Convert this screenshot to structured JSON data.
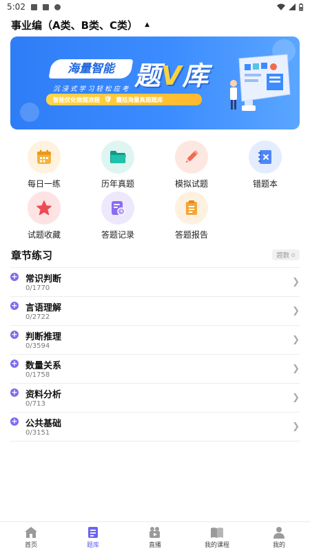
{
  "status": {
    "time": "5:02"
  },
  "header": {
    "exam_type": "事业编（A类、B类、C类）"
  },
  "banner": {
    "brand": "海量智能",
    "big_title_1": "题",
    "big_title_v": "V",
    "big_title_2": "库",
    "tagline": "沉浸式学习轻松应考",
    "badge_left": "智能优化做题流程",
    "badge_right": "囊括海量真题题库"
  },
  "grid": {
    "items": [
      {
        "label": "每日一练",
        "icon": "calendar-icon",
        "color": "#f5b23b",
        "bg": "#fff3df"
      },
      {
        "label": "历年真题",
        "icon": "folder-icon",
        "color": "#1fb6a0",
        "bg": "#dff5f1"
      },
      {
        "label": "模拟试题",
        "icon": "pencil-icon",
        "color": "#f26b50",
        "bg": "#fde7e1"
      },
      {
        "label": "错题本",
        "icon": "error-book-icon",
        "color": "#4f86f5",
        "bg": "#e3edfd"
      },
      {
        "label": "试题收藏",
        "icon": "star-icon",
        "color": "#ee4b53",
        "bg": "#fde3e4"
      },
      {
        "label": "答题记录",
        "icon": "record-icon",
        "color": "#8a6cf0",
        "bg": "#eee8fd"
      },
      {
        "label": "答题报告",
        "icon": "report-icon",
        "color": "#f5a535",
        "bg": "#fff1df"
      }
    ]
  },
  "chapter": {
    "title": "章节练习",
    "count_label": "题数",
    "items": [
      {
        "title": "常识判断",
        "progress": "0/1770"
      },
      {
        "title": "言语理解",
        "progress": "0/2722"
      },
      {
        "title": "判断推理",
        "progress": "0/3594"
      },
      {
        "title": "数量关系",
        "progress": "0/1758"
      },
      {
        "title": "资料分析",
        "progress": "0/713"
      },
      {
        "title": "公共基础",
        "progress": "0/3151"
      }
    ]
  },
  "tabs": [
    {
      "label": "首页",
      "icon": "home-icon"
    },
    {
      "label": "题库",
      "icon": "question-bank-icon",
      "active": true
    },
    {
      "label": "直播",
      "icon": "live-icon"
    },
    {
      "label": "我的课程",
      "icon": "course-icon"
    },
    {
      "label": "我的",
      "icon": "profile-icon"
    }
  ],
  "colors": {
    "accent": "#5b5ef0",
    "plus": "#7b6cf0",
    "banner_blue": "#2f7df6"
  }
}
